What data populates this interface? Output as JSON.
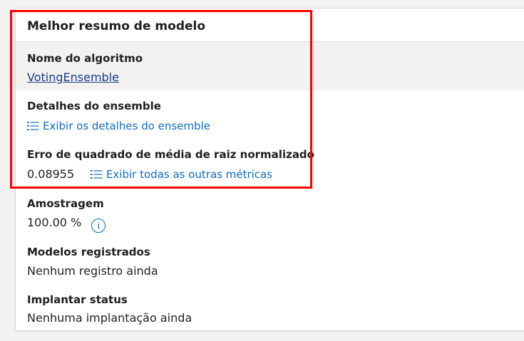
{
  "card": {
    "title": "Melhor resumo de modelo"
  },
  "algorithm": {
    "label": "Nome do algoritmo",
    "value": "VotingEnsemble"
  },
  "ensemble": {
    "label": "Detalhes do ensemble",
    "link_text": "Exibir os detalhes do ensemble",
    "icon": "list-icon"
  },
  "rmse": {
    "label": "Erro de quadrado de média de raiz normalizado",
    "value": "0.08955",
    "link_text": "Exibir todas as outras métricas",
    "icon": "list-icon"
  },
  "sampling": {
    "label": "Amostragem",
    "value": "100.00 %",
    "info_icon": "i"
  },
  "registered_models": {
    "label": "Modelos registrados",
    "value": "Nenhum registro ainda"
  },
  "deploy_status": {
    "label": "Implantar status",
    "value": "Nenhuma implantação ainda"
  },
  "colors": {
    "link": "#0f6cbd",
    "highlight_box": "#ff0000",
    "selected_row_bg": "#f3f2f1"
  }
}
